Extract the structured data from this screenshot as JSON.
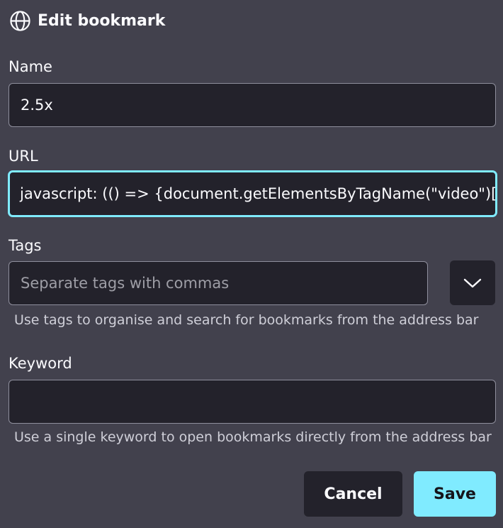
{
  "header": {
    "title": "Edit bookmark",
    "icon": "globe-icon"
  },
  "name": {
    "label": "Name",
    "value": "2.5x"
  },
  "url": {
    "label": "URL",
    "value": "javascript: (() => {document.getElementsByTagName(\"video\")["
  },
  "tags": {
    "label": "Tags",
    "placeholder": "Separate tags with commas",
    "value": "",
    "dropdown_icon": "chevron-down-icon",
    "hint": "Use tags to organise and search for bookmarks from the address bar"
  },
  "keyword": {
    "label": "Keyword",
    "value": "",
    "hint": "Use a single keyword to open bookmarks directly from the address bar"
  },
  "buttons": {
    "cancel": "Cancel",
    "save": "Save"
  },
  "colors": {
    "background": "#42414d",
    "field_background": "#23222b",
    "accent": "#80ebff",
    "text": "#fbfbfe"
  }
}
